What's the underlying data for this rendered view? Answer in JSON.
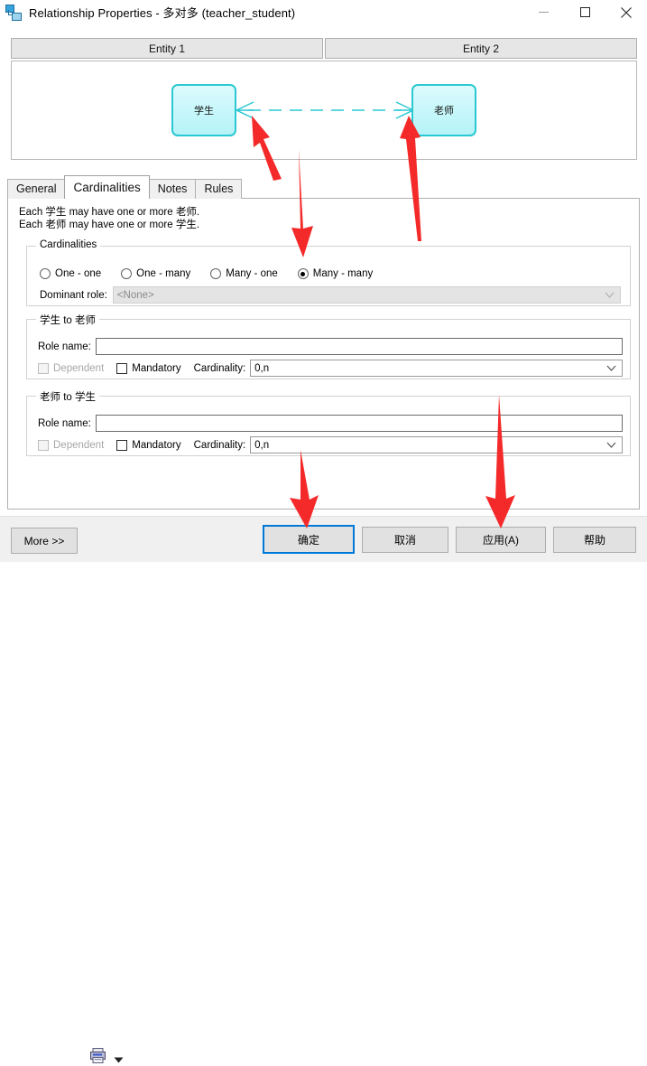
{
  "window": {
    "title": "Relationship Properties - 多对多 (teacher_student)",
    "icon": "relationship-icon",
    "minimize_label": "—",
    "maximize_label": "□",
    "close_label": "✕"
  },
  "entity_headers": [
    {
      "label": "Entity 1"
    },
    {
      "label": "Entity 2"
    }
  ],
  "diagram": {
    "left_entity": "学生",
    "right_entity": "老师",
    "link_style": "dashed",
    "entity_border_color": "#29c8d2",
    "entity_fill_color": "#bff5f9"
  },
  "tabs": [
    {
      "label": "General",
      "active": false
    },
    {
      "label": "Cardinalities",
      "active": true
    },
    {
      "label": "Notes",
      "active": false
    },
    {
      "label": "Rules",
      "active": false
    }
  ],
  "description": {
    "line1": "Each 学生 may have one or more 老师.",
    "line2": "Each 老师 may have one or more 学生."
  },
  "cardinalities_group": {
    "title": "Cardinalities",
    "options": [
      {
        "label": "One - one",
        "checked": false
      },
      {
        "label": "One - many",
        "checked": false
      },
      {
        "label": "Many - one",
        "checked": false
      },
      {
        "label": "Many - many",
        "checked": true
      }
    ],
    "dominant_role": {
      "label": "Dominant role:",
      "value": "<None>",
      "disabled": true
    }
  },
  "student_to_teacher": {
    "title": "学生 to 老师",
    "role_name_label": "Role name:",
    "role_name_value": "",
    "dependent_label": "Dependent",
    "dependent_checked": false,
    "dependent_disabled": true,
    "mandatory_label": "Mandatory",
    "mandatory_checked": false,
    "cardinality_label": "Cardinality:",
    "cardinality_value": "0,n"
  },
  "teacher_to_student": {
    "title": "老师 to 学生",
    "role_name_label": "Role name:",
    "role_name_value": "",
    "dependent_label": "Dependent",
    "dependent_checked": false,
    "dependent_disabled": true,
    "mandatory_label": "Mandatory",
    "mandatory_checked": false,
    "cardinality_label": "Cardinality:",
    "cardinality_value": "0,n"
  },
  "bottom_bar": {
    "more_label": "More >>",
    "print_icon": "printer-icon",
    "print_dropdown": "chevron-down-icon",
    "ok_label": "确定",
    "cancel_label": "取消",
    "apply_label": "应用(A)",
    "help_label": "帮助",
    "focused_button": "确定"
  },
  "annotations": {
    "color": "#f42a2a",
    "arrows": [
      "points-to-left-crowsfoot",
      "points-to-right-crowsfoot",
      "points-to-many-many-radio",
      "points-to-cardinality-0n",
      "points-to-ok-button",
      "points-to-apply-button"
    ]
  }
}
